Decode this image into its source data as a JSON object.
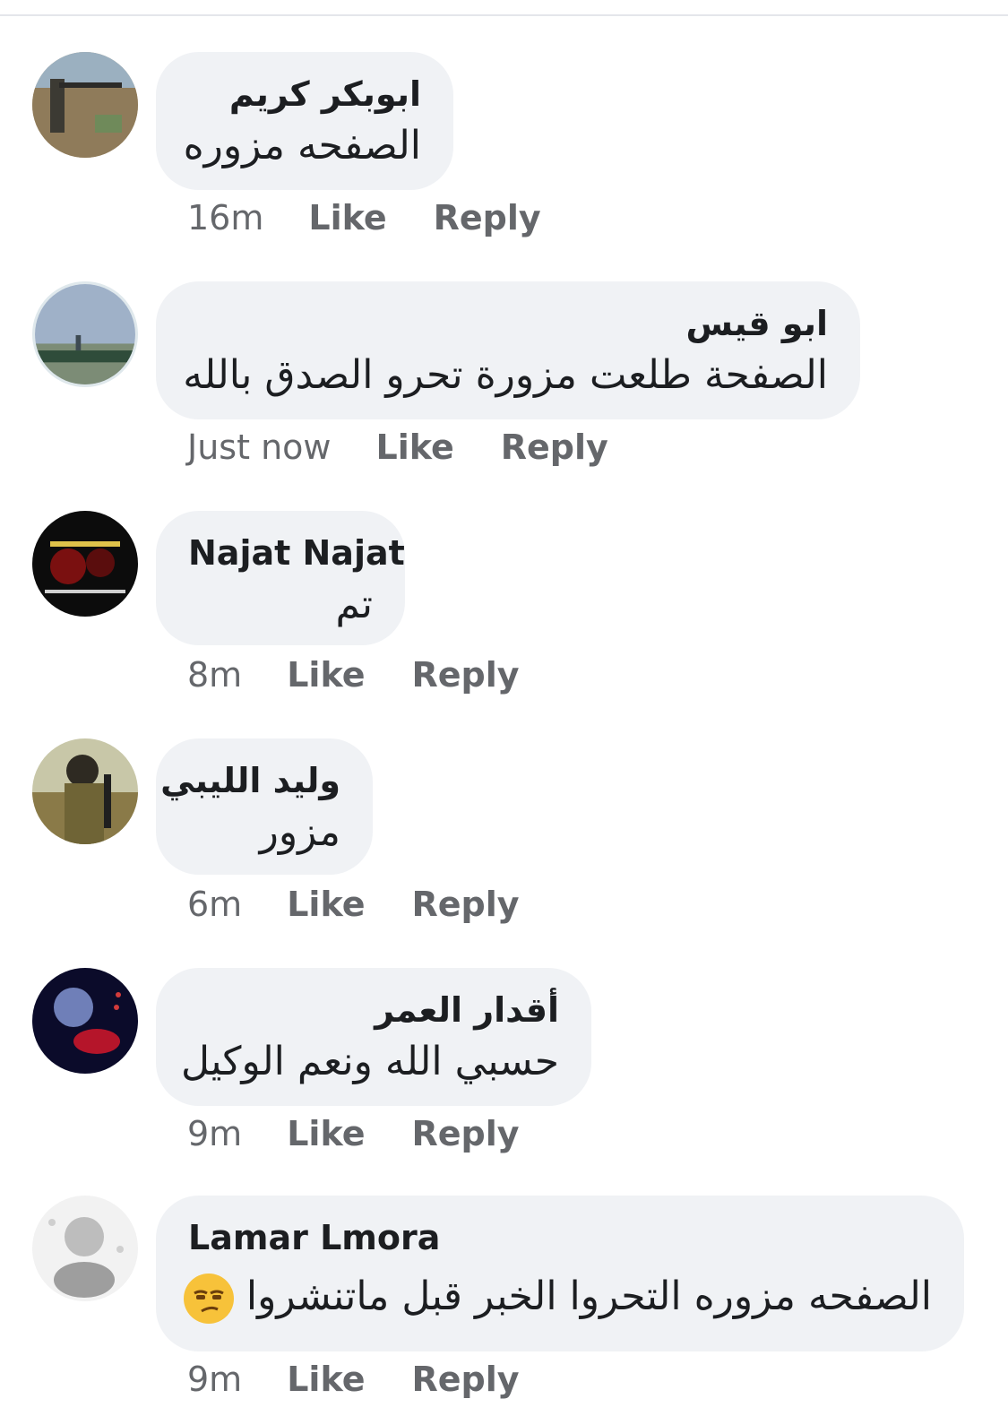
{
  "comments": [
    {
      "author": "ابوبكر كريم",
      "text": "الصفحه مزوره",
      "time": "16m",
      "like": "Like",
      "reply": "Reply"
    },
    {
      "author": "ابو قيس",
      "text": "الصفحة طلعت مزورة تحرو الصدق بالله",
      "time": "Just now",
      "like": "Like",
      "reply": "Reply"
    },
    {
      "author": "Najat Najat",
      "text": "تم",
      "time": "8m",
      "like": "Like",
      "reply": "Reply"
    },
    {
      "author": "وليد الليبي",
      "text": "مزور",
      "time": "6m",
      "like": "Like",
      "reply": "Reply"
    },
    {
      "author": "أقدار العمر",
      "text": "حسبي الله ونعم الوكيل",
      "time": "9m",
      "like": "Like",
      "reply": "Reply"
    },
    {
      "author": "Lamar Lmora",
      "text": "الصفحه مزوره التحروا الخبر قبل ماتنشروا",
      "emoji": "unamused-face-icon",
      "time": "9m",
      "like": "Like",
      "reply": "Reply"
    }
  ],
  "colors": {
    "bubble": "#f0f2f5",
    "meta": "#65676b",
    "text": "#1c1e21"
  }
}
